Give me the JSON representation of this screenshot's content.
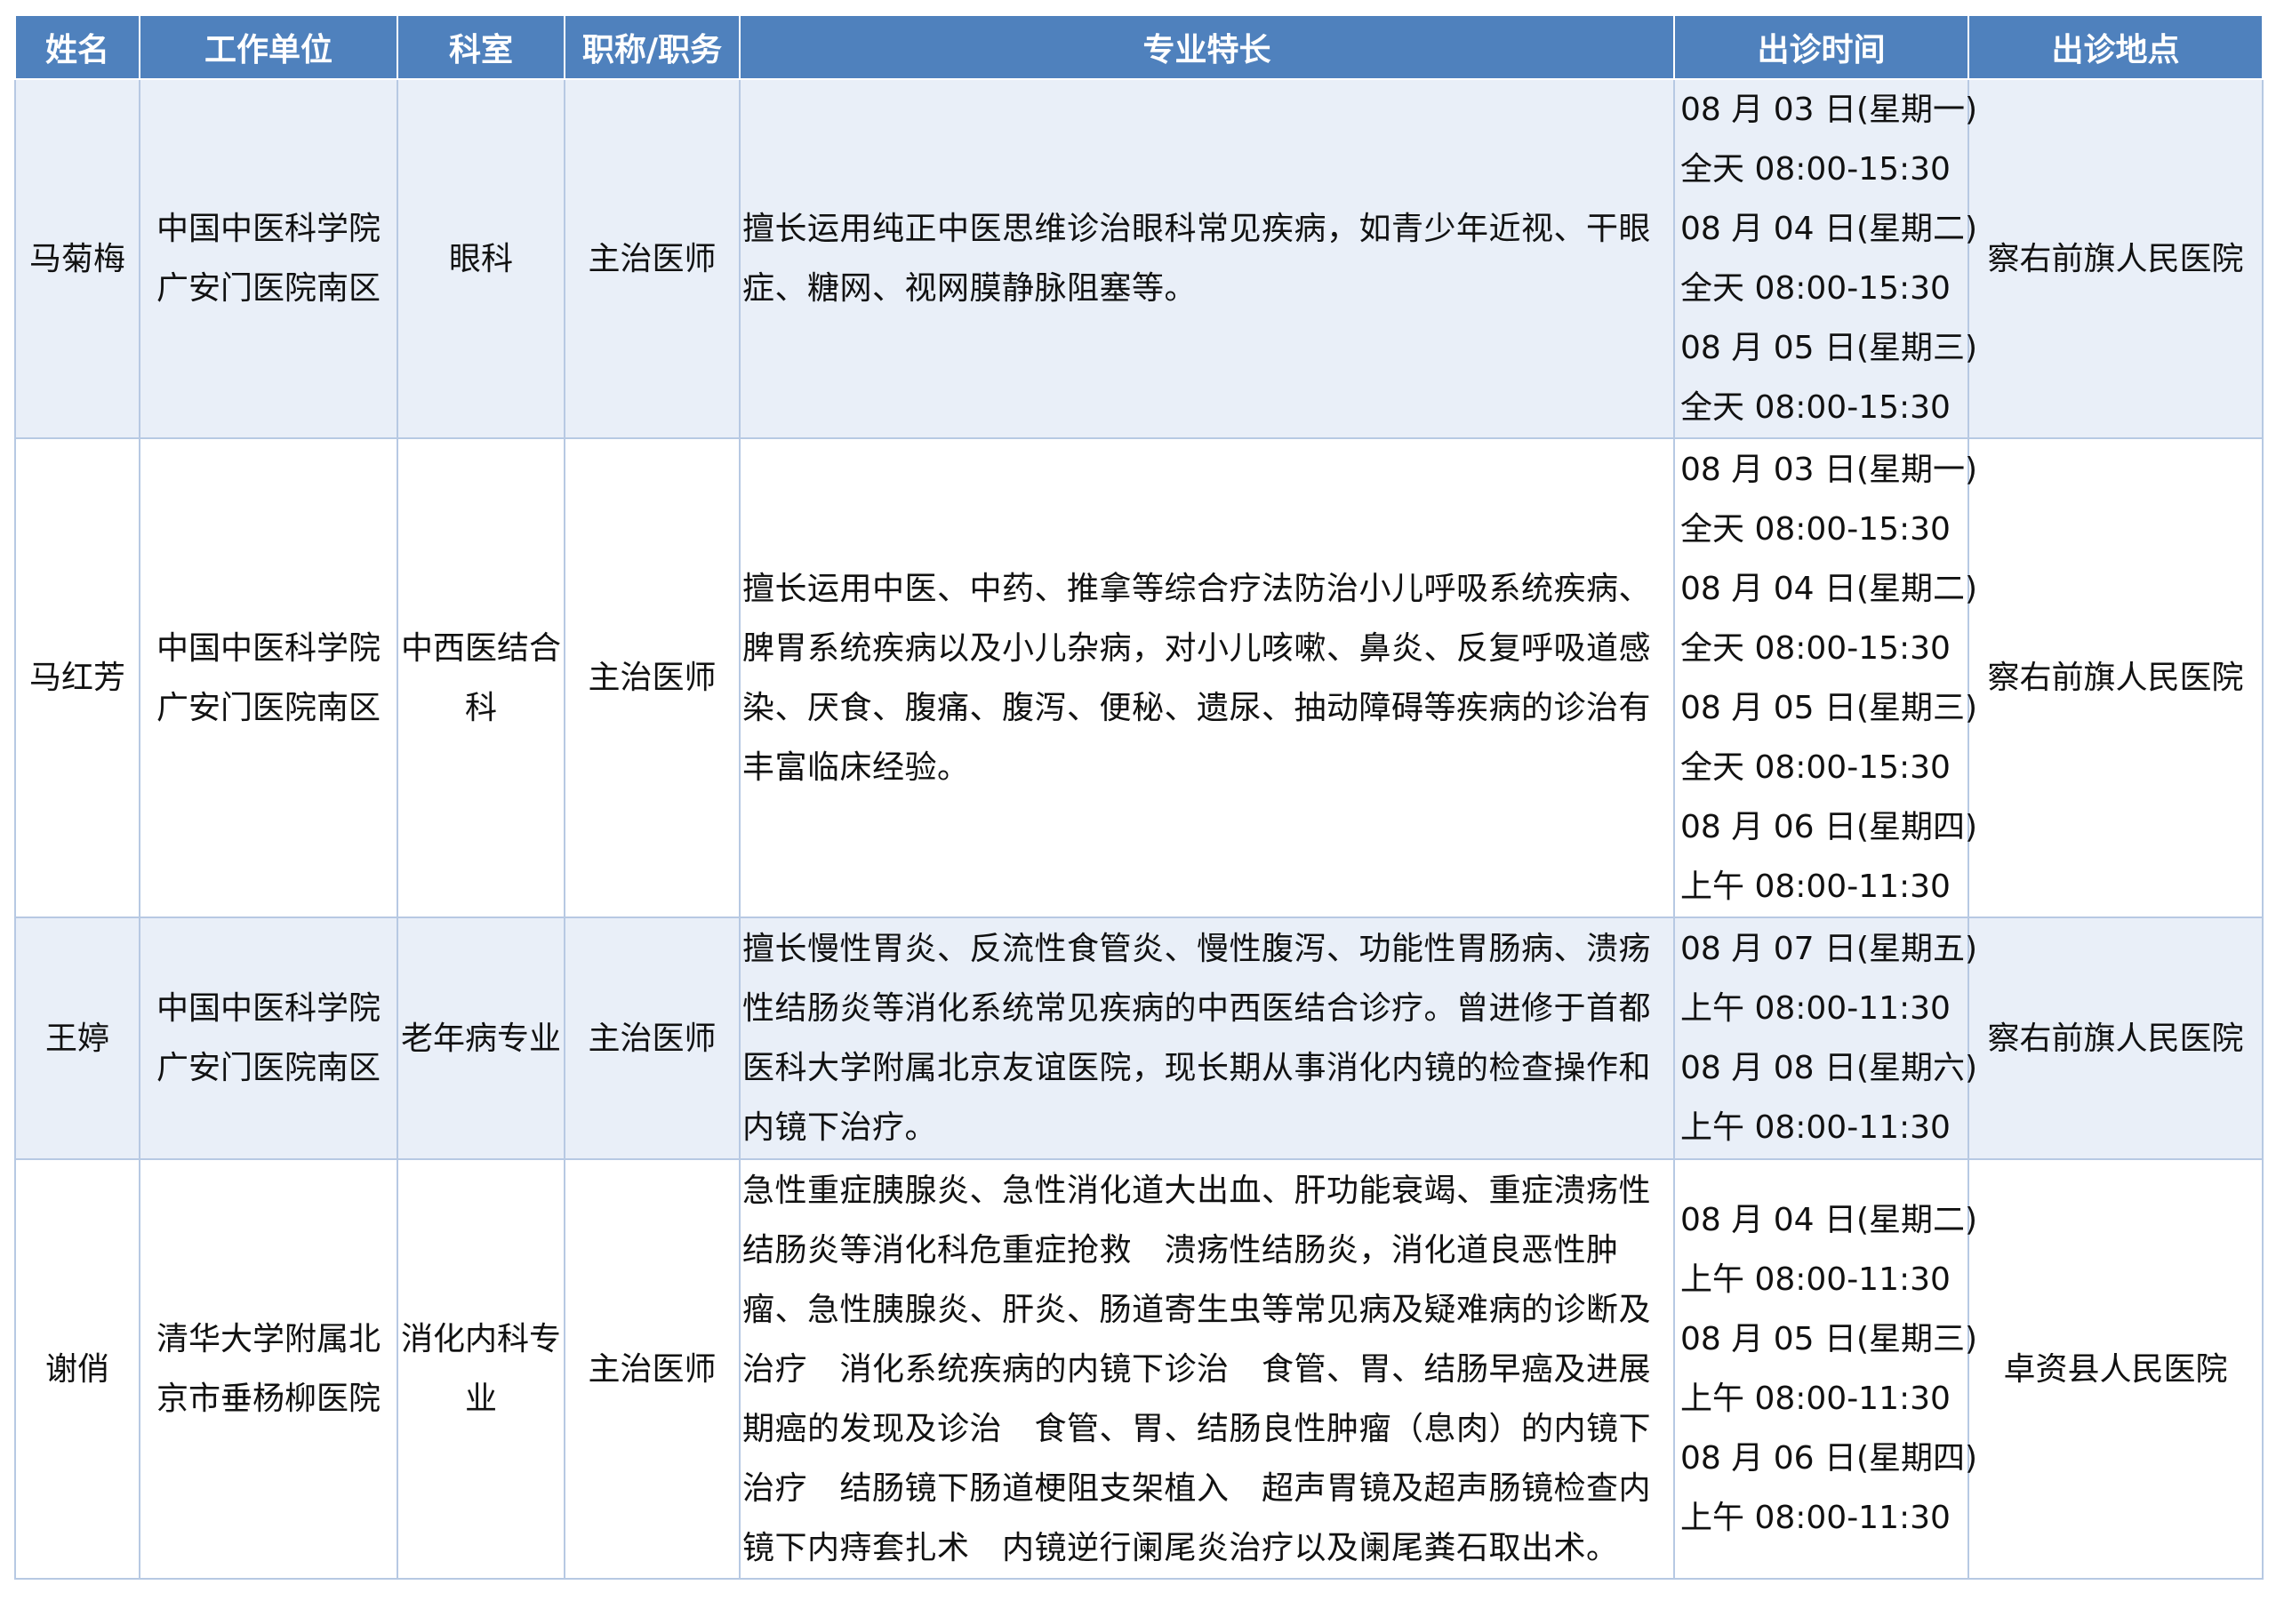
{
  "headers": [
    "姓名",
    "工作单位",
    "科室",
    "职称/职务",
    "专业特长",
    "出诊时间",
    "出诊地点"
  ],
  "rows": [
    {
      "name": "马菊梅",
      "unit": [
        "中国中医科学院",
        "广安门医院南区"
      ],
      "dept": [
        "眼科"
      ],
      "title": "主治医师",
      "specialty": "擅长运用纯正中医思维诊治眼科常见疾病，如青少年近视、干眼症、糖网、视网膜静脉阻塞等。",
      "schedule": [
        "08 月 03 日(星期一)",
        "全天 08:00-15:30",
        "08 月 04 日(星期二)",
        "全天 08:00-15:30",
        "08 月 05 日(星期三)",
        "全天 08:00-15:30"
      ],
      "location": "察右前旗人民医院"
    },
    {
      "name": "马红芳",
      "unit": [
        "中国中医科学院",
        "广安门医院南区"
      ],
      "dept": [
        "中西医结合",
        "科"
      ],
      "title": "主治医师",
      "specialty": "擅长运用中医、中药、推拿等综合疗法防治小儿呼吸系统疾病、脾胃系统疾病以及小儿杂病，对小儿咳嗽、鼻炎、反复呼吸道感染、厌食、腹痛、腹泻、便秘、遗尿、抽动障碍等疾病的诊治有丰富临床经验。",
      "schedule": [
        "08 月 03 日(星期一)",
        "全天 08:00-15:30",
        "08 月 04 日(星期二)",
        "全天 08:00-15:30",
        "08 月 05 日(星期三)",
        "全天 08:00-15:30",
        "08 月 06 日(星期四)",
        "上午 08:00-11:30"
      ],
      "location": "察右前旗人民医院"
    },
    {
      "name": "王婷",
      "unit": [
        "中国中医科学院",
        "广安门医院南区"
      ],
      "dept": [
        "老年病专业"
      ],
      "title": "主治医师",
      "specialty": "擅长慢性胃炎、反流性食管炎、慢性腹泻、功能性胃肠病、溃疡性结肠炎等消化系统常见疾病的中西医结合诊疗。曾进修于首都医科大学附属北京友谊医院，现长期从事消化内镜的检查操作和内镜下治疗。",
      "schedule": [
        "08 月 07 日(星期五)",
        "上午 08:00-11:30",
        "08 月 08 日(星期六)",
        "上午 08:00-11:30"
      ],
      "location": "察右前旗人民医院"
    },
    {
      "name": "谢俏",
      "unit": [
        "清华大学附属北",
        "京市垂杨柳医院"
      ],
      "dept": [
        "消化内科专",
        "业"
      ],
      "title": "主治医师",
      "specialty": "急性重症胰腺炎、急性消化道大出血、肝功能衰竭、重症溃疡性结肠炎等消化科危重症抢救　溃疡性结肠炎，消化道良恶性肿瘤、急性胰腺炎、肝炎、肠道寄生虫等常见病及疑难病的诊断及治疗　消化系统疾病的内镜下诊治　食管、胃、结肠早癌及进展期癌的发现及诊治　食管、胃、结肠良性肿瘤（息肉）的内镜下治疗　结肠镜下肠道梗阻支架植入　超声胃镜及超声肠镜检查内镜下内痔套扎术　内镜逆行阑尾炎治疗以及阑尾粪石取出术。",
      "schedule": [
        "08 月 04 日(星期二)",
        "上午 08:00-11:30",
        "08 月 05 日(星期三)",
        "上午 08:00-11:30",
        "08 月 06 日(星期四)",
        "上午 08:00-11:30"
      ],
      "location": "卓资县人民医院"
    }
  ]
}
